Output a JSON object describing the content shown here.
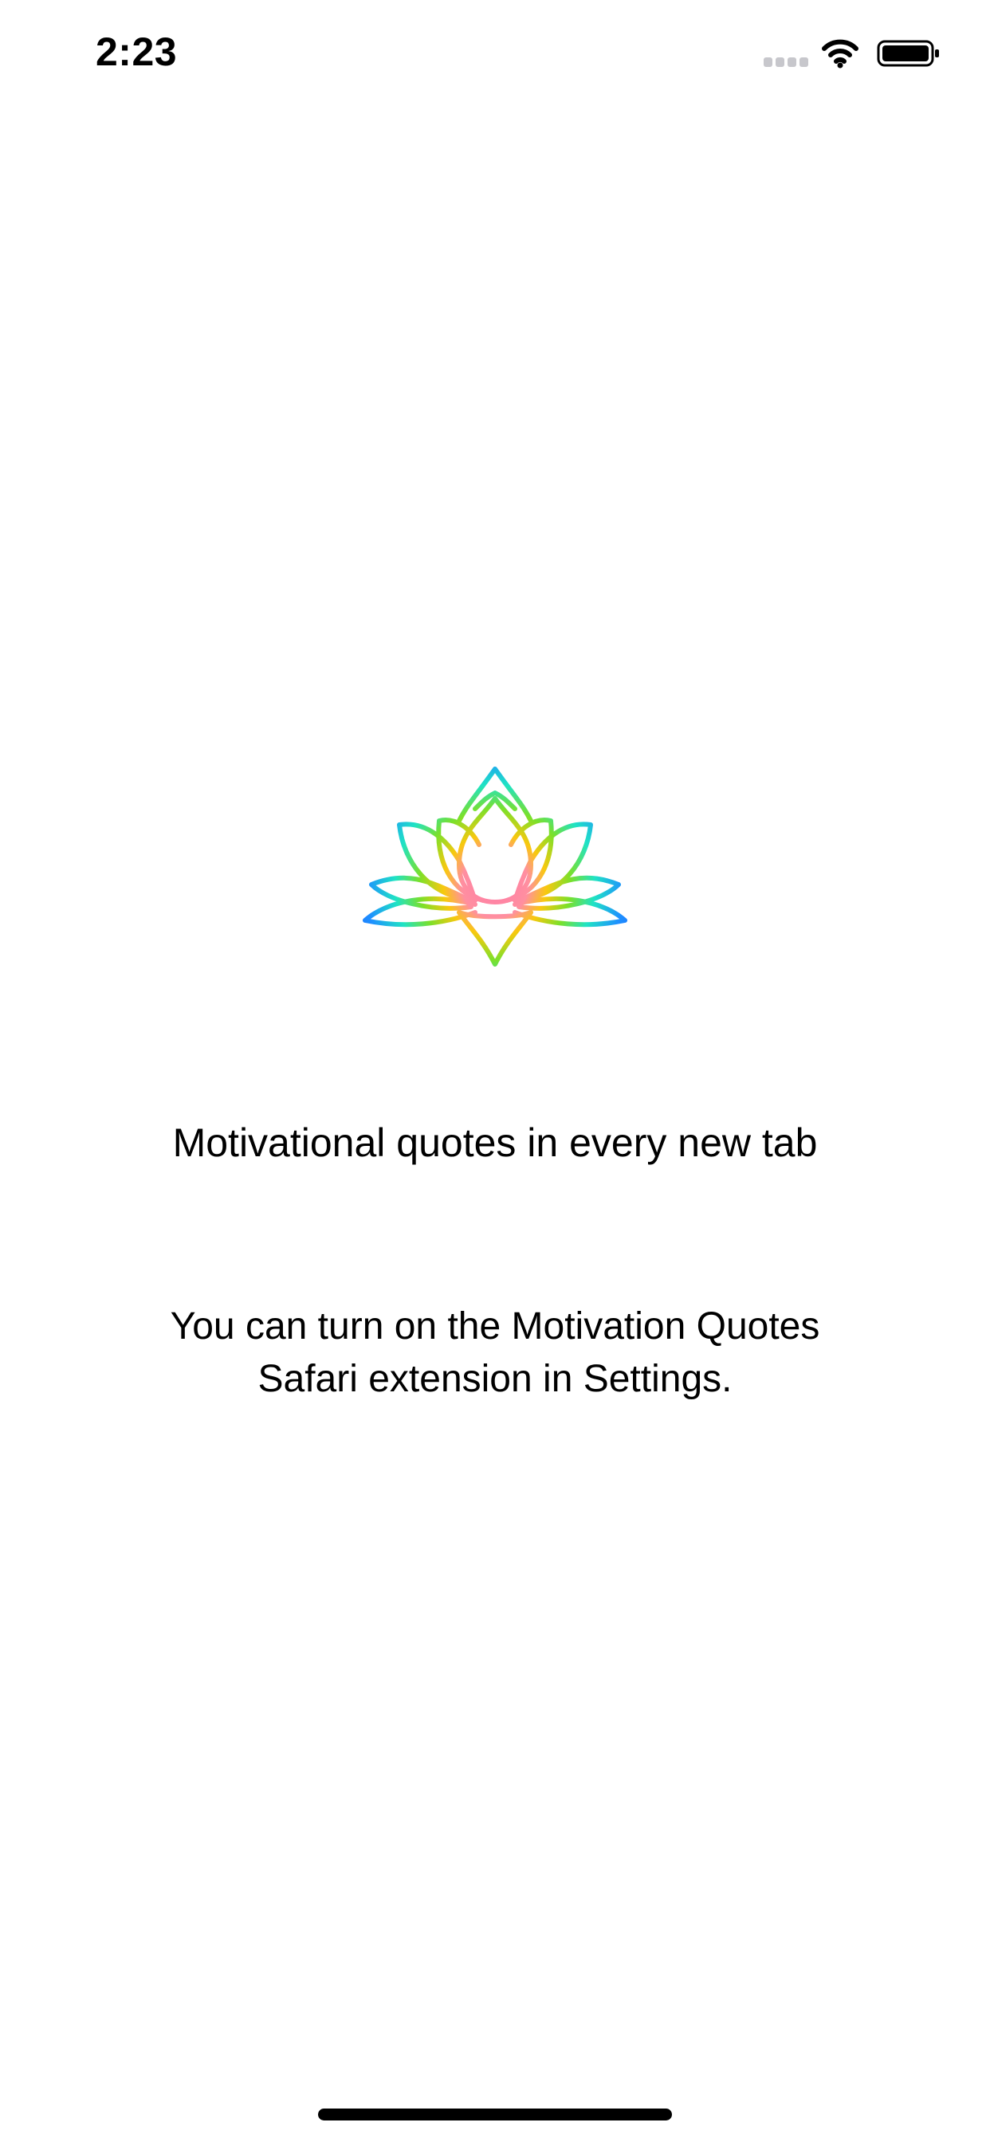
{
  "status_bar": {
    "time": "2:23",
    "icons": [
      "signal-icon",
      "wifi-icon",
      "battery-icon"
    ]
  },
  "logo": {
    "icon": "lotus-logo-icon",
    "colors": [
      "#ff7aa8",
      "#f9c80e",
      "#7be02a",
      "#1fe3c4",
      "#1e90ff"
    ]
  },
  "content": {
    "headline": "Motivational quotes in every new tab",
    "instructions": "You can turn on the Motivation Quotes Safari extension in Settings."
  }
}
